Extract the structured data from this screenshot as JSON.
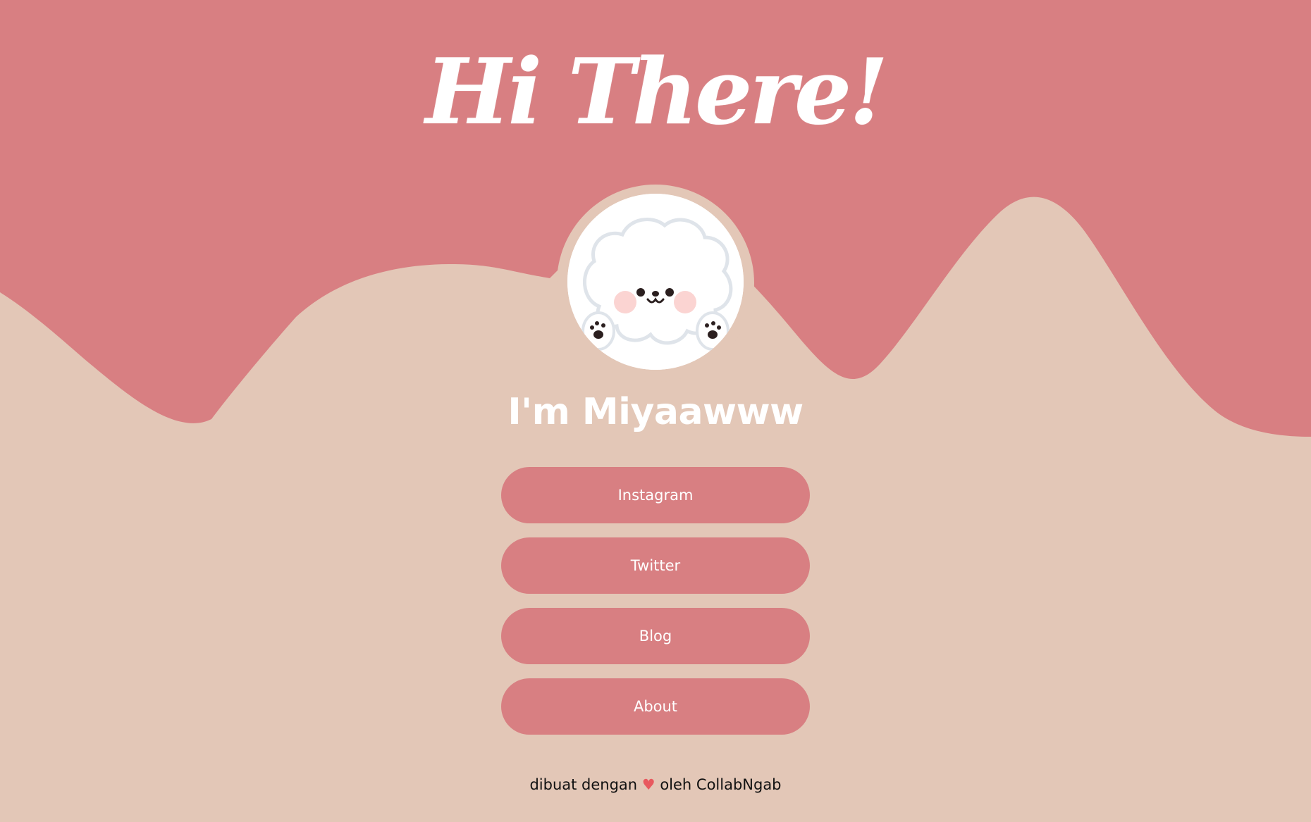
{
  "colors": {
    "background": "#e3c7b7",
    "wave": "#d87f82",
    "button": "#d87f82",
    "text_light": "#ffffff",
    "heart": "#e8595f"
  },
  "header": {
    "title": "Hi There!"
  },
  "profile": {
    "avatar_icon": "fluffy-dog-icon",
    "name": "I'm Miyaawww"
  },
  "links": [
    {
      "label": "Instagram"
    },
    {
      "label": "Twitter"
    },
    {
      "label": "Blog"
    },
    {
      "label": "About"
    }
  ],
  "footer": {
    "prefix": "dibuat dengan",
    "heart": "♥",
    "suffix": "oleh CollabNgab"
  }
}
